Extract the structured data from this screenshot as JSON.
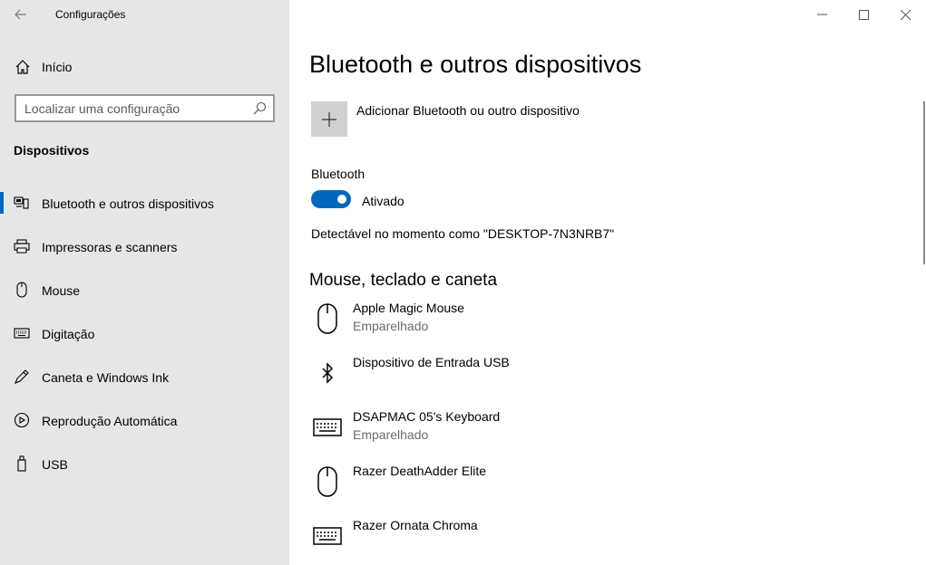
{
  "app": {
    "title": "Configurações"
  },
  "sidebar": {
    "home_label": "Início",
    "search_placeholder": "Localizar uma configuração",
    "section_title": "Dispositivos",
    "items": [
      {
        "label": "Bluetooth e outros dispositivos",
        "icon": "bluetooth-devices-icon",
        "active": true
      },
      {
        "label": "Impressoras e scanners",
        "icon": "printer-icon",
        "active": false
      },
      {
        "label": "Mouse",
        "icon": "mouse-icon",
        "active": false
      },
      {
        "label": "Digitação",
        "icon": "keyboard-icon",
        "active": false
      },
      {
        "label": "Caneta e Windows Ink",
        "icon": "pen-icon",
        "active": false
      },
      {
        "label": "Reprodução Automática",
        "icon": "autoplay-icon",
        "active": false
      },
      {
        "label": "USB",
        "icon": "usb-icon",
        "active": false
      }
    ]
  },
  "main": {
    "title": "Bluetooth e outros dispositivos",
    "add_label": "Adicionar Bluetooth ou outro dispositivo",
    "bluetooth_label": "Bluetooth",
    "toggle_state": "Ativado",
    "discoverable": "Detectável no momento como \"DESKTOP-7N3NRB7\"",
    "section_title": "Mouse, teclado e caneta",
    "devices": [
      {
        "name": "Apple Magic Mouse",
        "status": "Emparelhado",
        "icon": "mouse-icon"
      },
      {
        "name": "Dispositivo de Entrada USB",
        "status": "",
        "icon": "bluetooth-icon"
      },
      {
        "name": "DSAPMAC 05's Keyboard",
        "status": "Emparelhado",
        "icon": "keyboard-icon"
      },
      {
        "name": "Razer DeathAdder Elite",
        "status": "",
        "icon": "mouse-icon"
      },
      {
        "name": "Razer Ornata Chroma",
        "status": "",
        "icon": "keyboard-icon"
      }
    ]
  },
  "colors": {
    "accent": "#0067c0",
    "sidebar_bg": "#e6e6e6",
    "tile_bg": "#d1d1d1",
    "secondary_text": "#6b6b6b"
  }
}
